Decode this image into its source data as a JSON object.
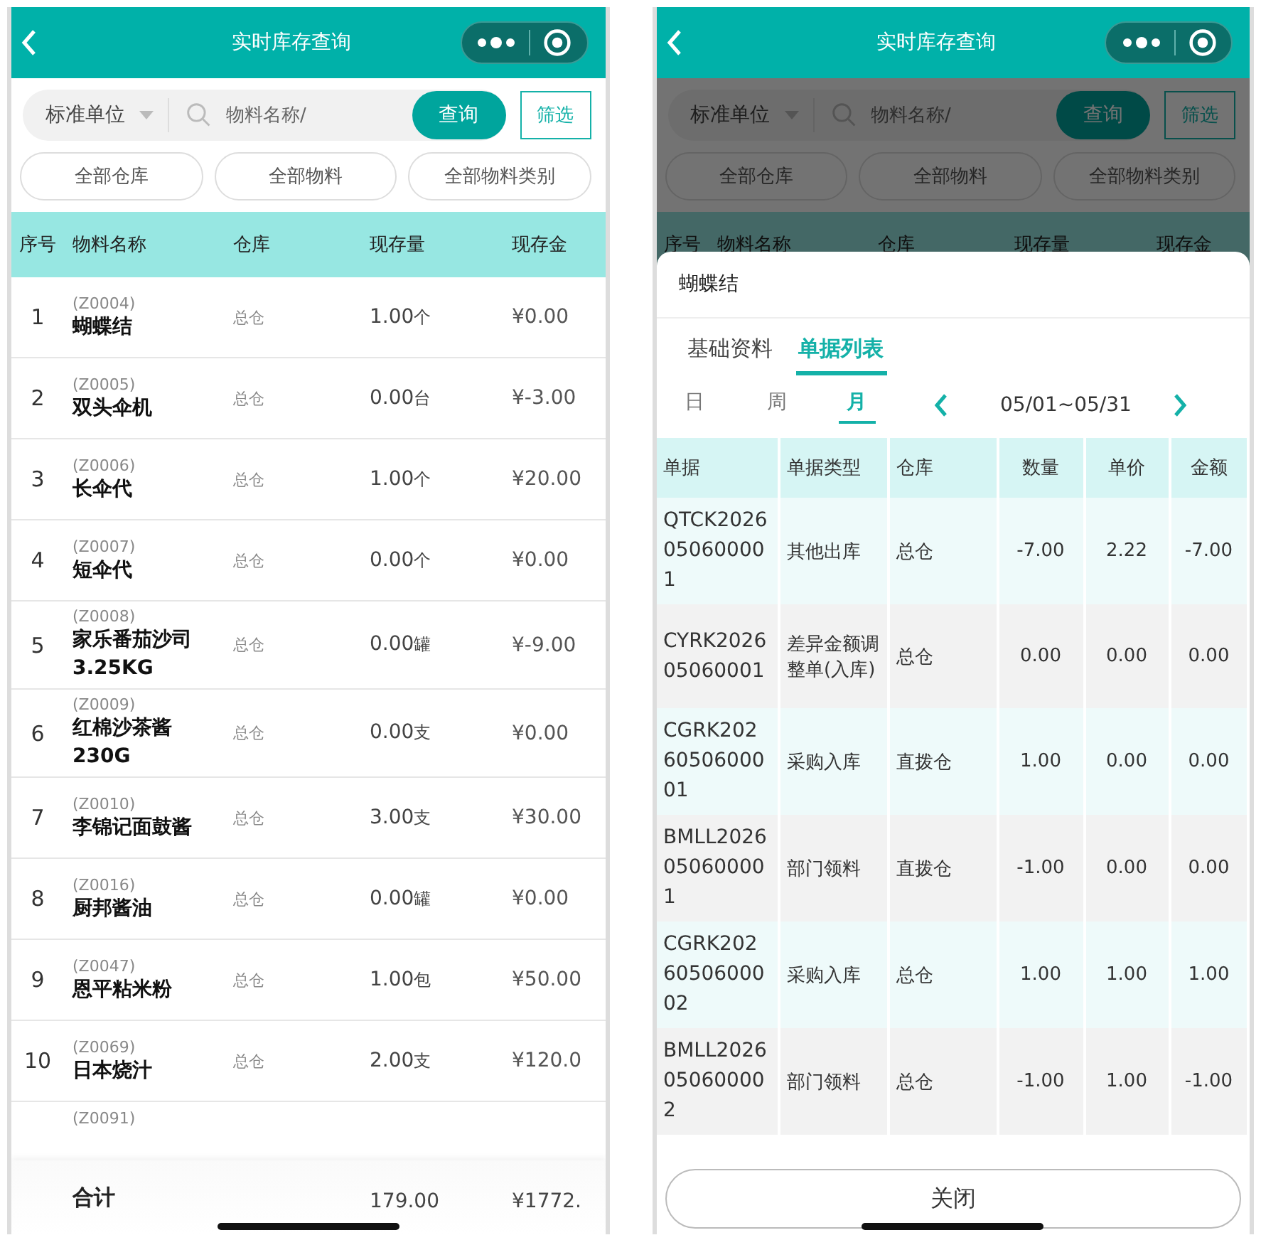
{
  "screens": [
    {
      "kind": "list",
      "title": "实时库存查询",
      "unit_select": "标准单位",
      "search": {
        "placeholder": "物料名称/"
      },
      "query_button": "查询",
      "filter_button": "筛选",
      "chips": [
        "全部仓库",
        "全部物料",
        "全部物料类别"
      ],
      "columns": [
        "序号",
        "物料名称",
        "仓库",
        "现存量",
        "现存金"
      ],
      "rows": [
        {
          "index": "1",
          "code": "(Z0004)",
          "name": "蝴蝶结",
          "warehouse": "总仓",
          "qty": "1.00",
          "unit": "个",
          "amount": "¥0.00"
        },
        {
          "index": "2",
          "code": "(Z0005)",
          "name": "双头伞机",
          "warehouse": "总仓",
          "qty": "0.00",
          "unit": "台",
          "amount": "¥-3.00"
        },
        {
          "index": "3",
          "code": "(Z0006)",
          "name": "长伞代",
          "warehouse": "总仓",
          "qty": "1.00",
          "unit": "个",
          "amount": "¥20.00"
        },
        {
          "index": "4",
          "code": "(Z0007)",
          "name": "短伞代",
          "warehouse": "总仓",
          "qty": "0.00",
          "unit": "个",
          "amount": "¥0.00"
        },
        {
          "index": "5",
          "code": "(Z0008)",
          "name": "家乐番茄沙司3.25KG",
          "warehouse": "总仓",
          "qty": "0.00",
          "unit": "罐",
          "amount": "¥-9.00"
        },
        {
          "index": "6",
          "code": "(Z0009)",
          "name": "红棉沙茶酱230G",
          "warehouse": "总仓",
          "qty": "0.00",
          "unit": "支",
          "amount": "¥0.00"
        },
        {
          "index": "7",
          "code": "(Z0010)",
          "name": "李锦记面鼓酱",
          "warehouse": "总仓",
          "qty": "3.00",
          "unit": "支",
          "amount": "¥30.00"
        },
        {
          "index": "8",
          "code": "(Z0016)",
          "name": "厨邦酱油",
          "warehouse": "总仓",
          "qty": "0.00",
          "unit": "罐",
          "amount": "¥0.00"
        },
        {
          "index": "9",
          "code": "(Z0047)",
          "name": "恩平粘米粉",
          "warehouse": "总仓",
          "qty": "1.00",
          "unit": "包",
          "amount": "¥50.00"
        },
        {
          "index": "10",
          "code": "(Z0069)",
          "name": "日本烧汁",
          "warehouse": "总仓",
          "qty": "2.00",
          "unit": "支",
          "amount": "¥120.0"
        }
      ],
      "partial_row_code": "(Z0091)",
      "total": {
        "label": "合计",
        "qty": "179.00",
        "amount": "¥1772."
      }
    },
    {
      "kind": "detail",
      "title": "实时库存查询",
      "unit_select": "标准单位",
      "search": {
        "placeholder": "物料名称/"
      },
      "query_button": "查询",
      "filter_button": "筛选",
      "chips": [
        "全部仓库",
        "全部物料",
        "全部物料类别"
      ],
      "columns": [
        "序号",
        "物料名称",
        "仓库",
        "现存量",
        "现存金"
      ],
      "sheet": {
        "title": "蝴蝶结",
        "tabs": [
          {
            "label": "基础资料",
            "selected": false
          },
          {
            "label": "单据列表",
            "selected": true
          }
        ],
        "periods": [
          {
            "label": "日",
            "selected": false
          },
          {
            "label": "周",
            "selected": false
          },
          {
            "label": "月",
            "selected": true
          }
        ],
        "date_range": "05/01~05/31",
        "columns": [
          "单据",
          "单据类型",
          "仓库",
          "数量",
          "单价",
          "金额"
        ],
        "rows": [
          {
            "doc": "QTCK2026050600001",
            "type": "其他出库",
            "warehouse": "总仓",
            "qty": "-7.00",
            "price": "2.22",
            "amount": "-7.00"
          },
          {
            "doc": "CYRK202605060001",
            "type": "差异金额调整单(入库)",
            "warehouse": "总仓",
            "qty": "0.00",
            "price": "0.00",
            "amount": "0.00"
          },
          {
            "doc": "CGRK2026050600001",
            "type": "采购入库",
            "warehouse": "直拨仓",
            "qty": "1.00",
            "price": "0.00",
            "amount": "0.00"
          },
          {
            "doc": "BMLL2026050600001",
            "type": "部门领料",
            "warehouse": "直拨仓",
            "qty": "-1.00",
            "price": "0.00",
            "amount": "0.00"
          },
          {
            "doc": "CGRK2026050600002",
            "type": "采购入库",
            "warehouse": "总仓",
            "qty": "1.00",
            "price": "1.00",
            "amount": "1.00"
          },
          {
            "doc": "BMLL2026050600002",
            "type": "部门领料",
            "warehouse": "总仓",
            "qty": "-1.00",
            "price": "1.00",
            "amount": "-1.00"
          }
        ],
        "close_button": "关闭"
      }
    }
  ]
}
